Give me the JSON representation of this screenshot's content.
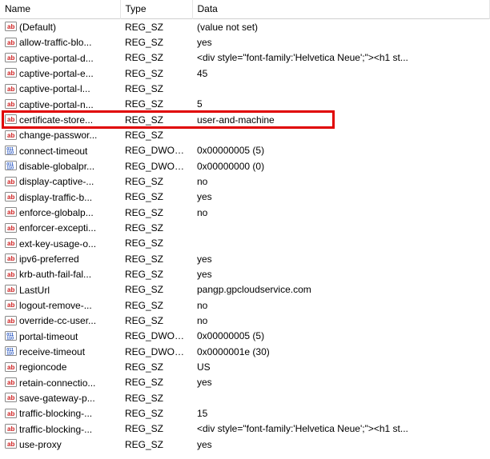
{
  "columns": {
    "name": "Name",
    "type": "Type",
    "data": "Data"
  },
  "highlighted_index": 6,
  "rows": [
    {
      "icon": "sz",
      "name": "(Default)",
      "type": "REG_SZ",
      "data": "(value not set)"
    },
    {
      "icon": "sz",
      "name": "allow-traffic-blo...",
      "type": "REG_SZ",
      "data": "yes"
    },
    {
      "icon": "sz",
      "name": "captive-portal-d...",
      "type": "REG_SZ",
      "data": "<div style=\"font-family:'Helvetica Neue';\"><h1 st..."
    },
    {
      "icon": "sz",
      "name": "captive-portal-e...",
      "type": "REG_SZ",
      "data": "45"
    },
    {
      "icon": "sz",
      "name": "captive-portal-l...",
      "type": "REG_SZ",
      "data": ""
    },
    {
      "icon": "sz",
      "name": "captive-portal-n...",
      "type": "REG_SZ",
      "data": "5"
    },
    {
      "icon": "sz",
      "name": "certificate-store...",
      "type": "REG_SZ",
      "data": "user-and-machine"
    },
    {
      "icon": "sz",
      "name": "change-passwor...",
      "type": "REG_SZ",
      "data": ""
    },
    {
      "icon": "dword",
      "name": "connect-timeout",
      "type": "REG_DWORD",
      "data": "0x00000005 (5)"
    },
    {
      "icon": "dword",
      "name": "disable-globalpr...",
      "type": "REG_DWORD",
      "data": "0x00000000 (0)"
    },
    {
      "icon": "sz",
      "name": "display-captive-...",
      "type": "REG_SZ",
      "data": "no"
    },
    {
      "icon": "sz",
      "name": "display-traffic-b...",
      "type": "REG_SZ",
      "data": "yes"
    },
    {
      "icon": "sz",
      "name": "enforce-globalp...",
      "type": "REG_SZ",
      "data": "no"
    },
    {
      "icon": "sz",
      "name": "enforcer-excepti...",
      "type": "REG_SZ",
      "data": ""
    },
    {
      "icon": "sz",
      "name": "ext-key-usage-o...",
      "type": "REG_SZ",
      "data": ""
    },
    {
      "icon": "sz",
      "name": "ipv6-preferred",
      "type": "REG_SZ",
      "data": "yes"
    },
    {
      "icon": "sz",
      "name": "krb-auth-fail-fal...",
      "type": "REG_SZ",
      "data": "yes"
    },
    {
      "icon": "sz",
      "name": "LastUrl",
      "type": "REG_SZ",
      "data": "pangp.gpcloudservice.com"
    },
    {
      "icon": "sz",
      "name": "logout-remove-...",
      "type": "REG_SZ",
      "data": "no"
    },
    {
      "icon": "sz",
      "name": "override-cc-user...",
      "type": "REG_SZ",
      "data": "no"
    },
    {
      "icon": "dword",
      "name": "portal-timeout",
      "type": "REG_DWORD",
      "data": "0x00000005 (5)"
    },
    {
      "icon": "dword",
      "name": "receive-timeout",
      "type": "REG_DWORD",
      "data": "0x0000001e (30)"
    },
    {
      "icon": "sz",
      "name": "regioncode",
      "type": "REG_SZ",
      "data": "US"
    },
    {
      "icon": "sz",
      "name": "retain-connectio...",
      "type": "REG_SZ",
      "data": "yes"
    },
    {
      "icon": "sz",
      "name": "save-gateway-p...",
      "type": "REG_SZ",
      "data": ""
    },
    {
      "icon": "sz",
      "name": "traffic-blocking-...",
      "type": "REG_SZ",
      "data": "15"
    },
    {
      "icon": "sz",
      "name": "traffic-blocking-...",
      "type": "REG_SZ",
      "data": "<div style=\"font-family:'Helvetica Neue';\"><h1 st..."
    },
    {
      "icon": "sz",
      "name": "use-proxy",
      "type": "REG_SZ",
      "data": "yes"
    }
  ]
}
